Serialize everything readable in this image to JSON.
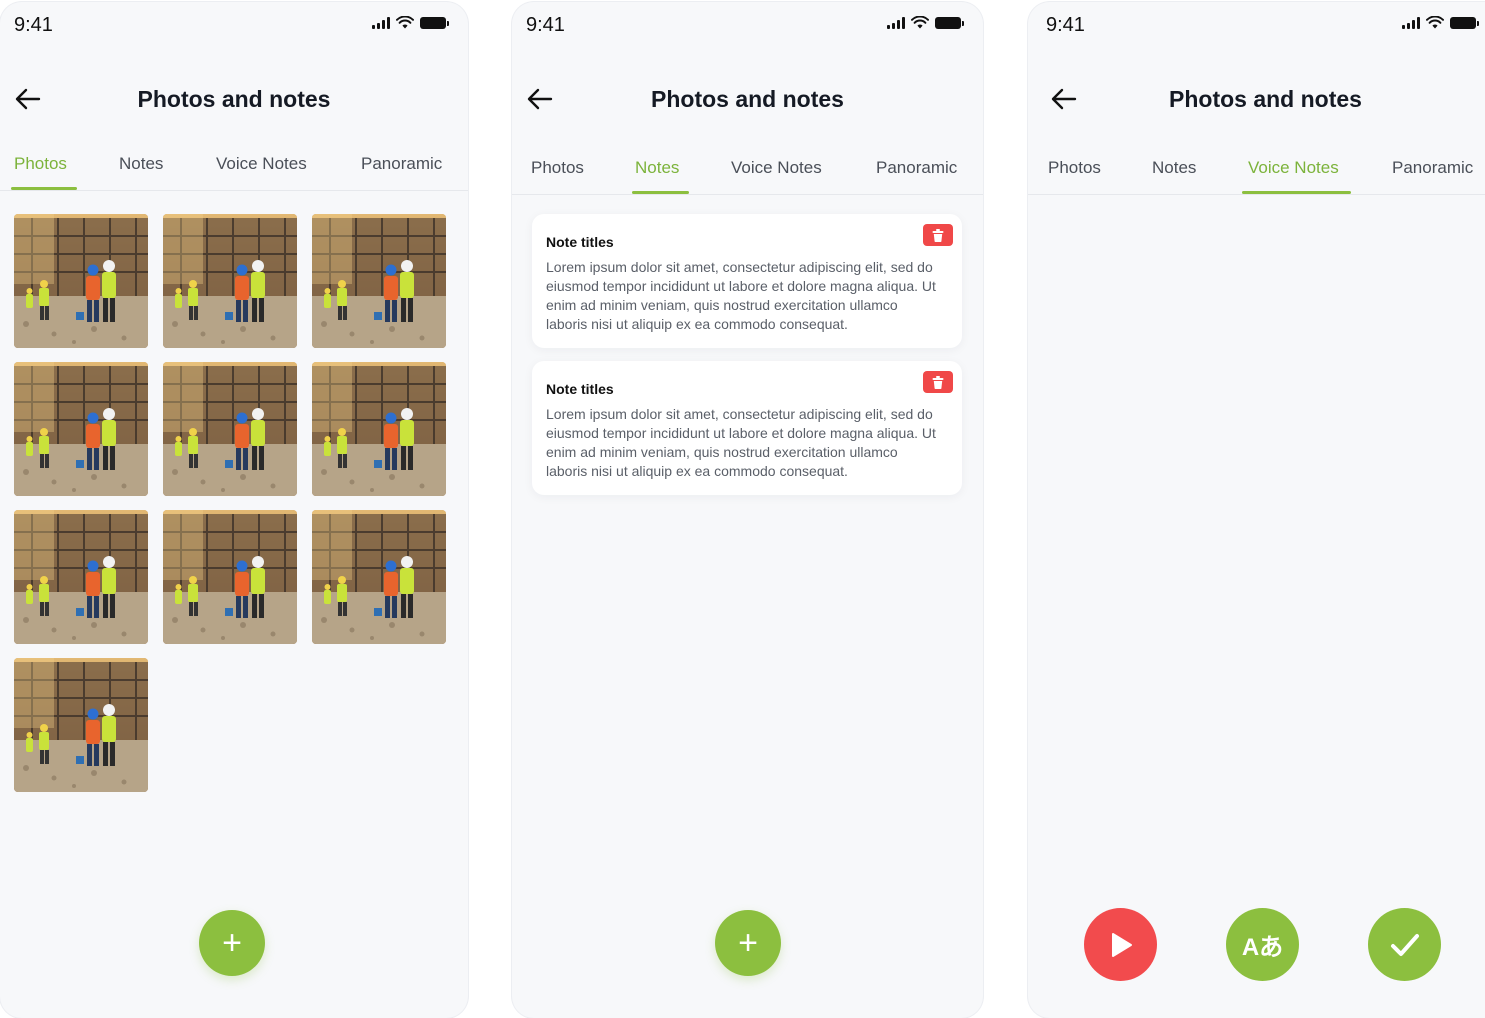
{
  "status_time": "9:41",
  "screen_title": "Photos and notes",
  "tabs": [
    "Photos",
    "Notes",
    "Voice Notes",
    "Panoramic"
  ],
  "screens": [
    {
      "active_tab": "Photos",
      "photo_count": 10
    },
    {
      "active_tab": "Notes"
    },
    {
      "active_tab": "Voice Notes"
    }
  ],
  "notes": [
    {
      "title": "Note titles",
      "body": "Lorem ipsum dolor sit amet, consectetur adipiscing elit, sed do eiusmod tempor incididunt ut labore et dolore magna aliqua. Ut enim ad minim veniam, quis nostrud exercitation ullamco laboris nisi ut aliquip ex ea commodo consequat."
    },
    {
      "title": "Note titles",
      "body": "Lorem ipsum dolor sit amet, consectetur adipiscing elit, sed do eiusmod tempor incididunt ut labore et dolore magna aliqua. Ut enim ad minim veniam, quis nostrud exercitation ullamco laboris nisi ut aliquip ex ea commodo consequat."
    }
  ],
  "add_button_symbol": "+",
  "voice_actions": {
    "play_icon": "play-icon",
    "translate_label": "Aあ",
    "confirm_icon": "check-icon"
  },
  "colors": {
    "accent_green": "#8cbf3f",
    "danger_red": "#f24b4d",
    "background": "#f7f8fa"
  }
}
